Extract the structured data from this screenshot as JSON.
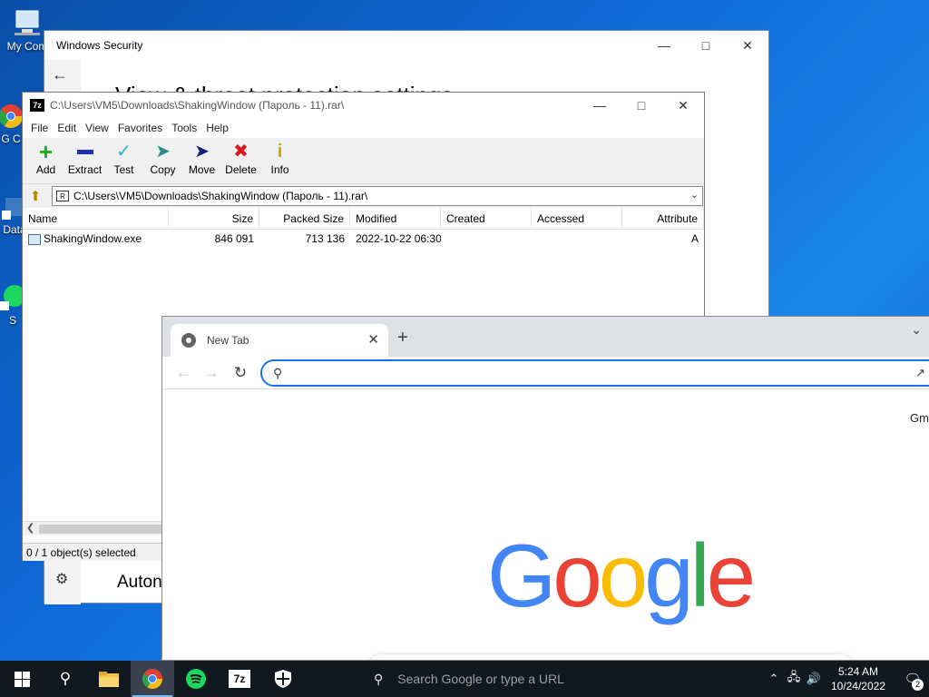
{
  "desktop": {
    "icons": [
      {
        "label": "My Com"
      },
      {
        "label": "G C"
      },
      {
        "label": "Data"
      },
      {
        "label": "S"
      }
    ]
  },
  "windows_security": {
    "title": "Windows Security",
    "heading": "View & threat protection settings",
    "bottom_text": "Auton"
  },
  "sevenzip": {
    "title": "C:\\Users\\VM5\\Downloads\\ShakingWindow (Пароль - 11).rar\\",
    "menu": [
      "File",
      "Edit",
      "View",
      "Favorites",
      "Tools",
      "Help"
    ],
    "toolbar": [
      {
        "label": "Add",
        "icon": "plus-icon",
        "color": "#1db11d"
      },
      {
        "label": "Extract",
        "icon": "minus-icon",
        "color": "#1b2fb3"
      },
      {
        "label": "Test",
        "icon": "check-icon",
        "color": "#29b8c8"
      },
      {
        "label": "Copy",
        "icon": "arrow-right-icon",
        "color": "#2e8a87"
      },
      {
        "label": "Move",
        "icon": "arrow-right-icon",
        "color": "#0f1f7a"
      },
      {
        "label": "Delete",
        "icon": "x-icon",
        "color": "#d9191f"
      },
      {
        "label": "Info",
        "icon": "info-icon",
        "color": "#caa800"
      }
    ],
    "path": "C:\\Users\\VM5\\Downloads\\ShakingWindow (Пароль - 11).rar\\",
    "columns": [
      "Name",
      "Size",
      "Packed Size",
      "Modified",
      "Created",
      "Accessed",
      "Attribute"
    ],
    "rows": [
      {
        "name": "ShakingWindow.exe",
        "size": "846 091",
        "packed": "713 136",
        "modified": "2022-10-22 06:30",
        "created": "",
        "accessed": "",
        "attr": "A"
      }
    ],
    "status": "0 / 1 object(s) selected"
  },
  "chrome": {
    "tab_title": "New Tab",
    "omnibox_value": "",
    "gmail": "Gm",
    "logo": "Google",
    "logo_colors": [
      "#4285f4",
      "#ea4335",
      "#fbbc05",
      "#4285f4",
      "#34a853",
      "#ea4335"
    ],
    "search_placeholder": "Search Google or type a URL"
  },
  "taskbar": {
    "time": "5:24 AM",
    "date": "10/24/2022",
    "notifications": "2",
    "apps": [
      "start-icon",
      "search-icon",
      "file-explorer-icon",
      "chrome-icon",
      "spotify-icon",
      "7zip-icon",
      "windows-security-icon"
    ]
  }
}
